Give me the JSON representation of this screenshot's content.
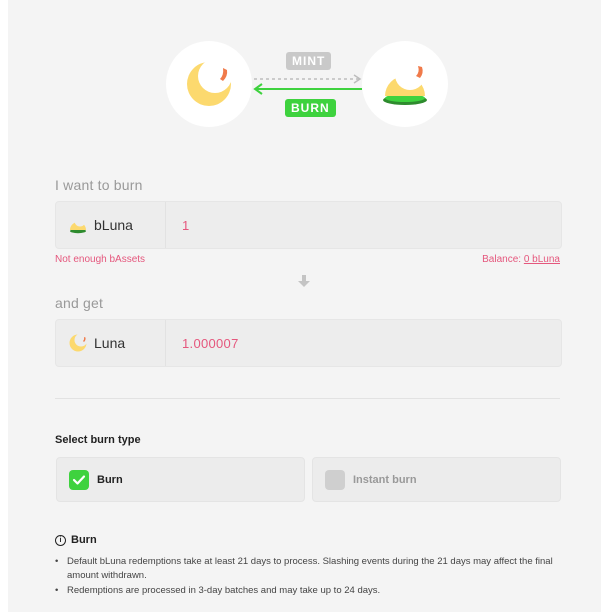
{
  "hero": {
    "mint_tag": "MINT",
    "burn_tag": "BURN",
    "left_token_icon": "luna-moon-icon",
    "right_token_icon": "bluna-moon-icon"
  },
  "burn": {
    "label": "I want to burn",
    "asset": "bLuna",
    "amount": "1",
    "error": "Not enough bAssets",
    "balance_label": "Balance:",
    "balance_value": "0 bLuna"
  },
  "get": {
    "label": "and get",
    "asset": "Luna",
    "amount": "1.000007"
  },
  "burn_type": {
    "title": "Select burn type",
    "options": [
      {
        "label": "Burn",
        "selected": true
      },
      {
        "label": "Instant burn",
        "selected": false
      }
    ]
  },
  "info": {
    "title": "Burn",
    "notes": [
      "Default bLuna redemptions take at least 21 days to process. Slashing events during the 21 days may affect the final amount withdrawn.",
      "Redemptions are processed in 3-day batches and may take up to 24 days."
    ]
  },
  "colors": {
    "accent_green": "#3ed23e",
    "error_pink": "#e5577d",
    "moon_yellow": "#fcd96e"
  }
}
